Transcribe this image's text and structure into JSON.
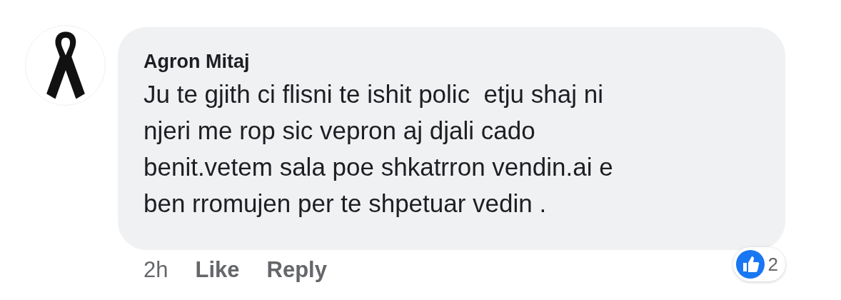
{
  "comment": {
    "author": "Agron Mitaj",
    "text": "Ju te gjith ci flisni te ishit polic  etju shaj ni\nnjeri me rop sic vepron aj djali cado\nbenit.vetem sala poe shkatrron vendin.ai e\nben rromujen per te shpetuar vedin .",
    "time": "2h",
    "actions": [
      "Like",
      "Reply"
    ],
    "reactions": {
      "count": "2"
    }
  }
}
